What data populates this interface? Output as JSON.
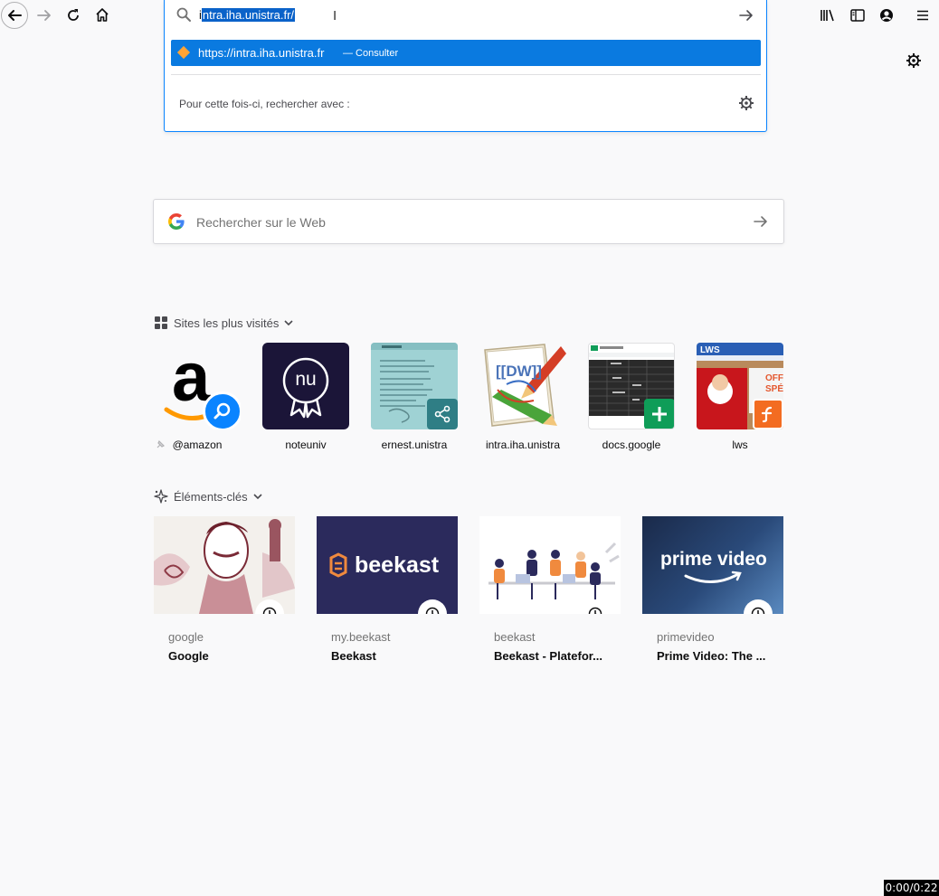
{
  "toolbar": {
    "back": "back-arrow-icon",
    "forward": "forward-arrow-icon",
    "reload": "reload-icon",
    "home": "home-icon",
    "library": "library-icon",
    "sidebar": "sidebar-icon",
    "account": "account-icon",
    "menu": "hamburger-menu-icon"
  },
  "urlbar": {
    "first_char": "i",
    "selected_text": "ntra.iha.unistra.fr/",
    "suggestion_url": "https://intra.iha.unistra.fr",
    "suggestion_action": "— Consulter",
    "one_off_label": "Pour cette fois-ci, rechercher avec :"
  },
  "web_search": {
    "placeholder": "Rechercher sur le Web"
  },
  "top_sites": {
    "heading": "Sites les plus visités",
    "items": [
      {
        "label": "@amazon"
      },
      {
        "label": "noteuniv",
        "logo_text": "nu"
      },
      {
        "label": "ernest.unistra"
      },
      {
        "label": "intra.iha.unistra",
        "logo_text": "[[DW]]"
      },
      {
        "label": "docs.google"
      },
      {
        "label": "lws",
        "promo_text": "OFFR SPÉC"
      }
    ]
  },
  "highlights": {
    "heading": "Éléments-clés",
    "items": [
      {
        "host": "google",
        "title": "Google"
      },
      {
        "host": "my.beekast",
        "title": "Beekast",
        "image_text": "beekast"
      },
      {
        "host": "beekast",
        "title": "Beekast - Platefor..."
      },
      {
        "host": "primevideo",
        "title": "Prime Video: The ...",
        "image_text": "prime video"
      }
    ]
  },
  "timer": "0:00/0:22",
  "colors": {
    "accent": "#0a84ff",
    "suggestion_bg": "#0a7ae0",
    "page_bg": "#f9f9fa"
  }
}
